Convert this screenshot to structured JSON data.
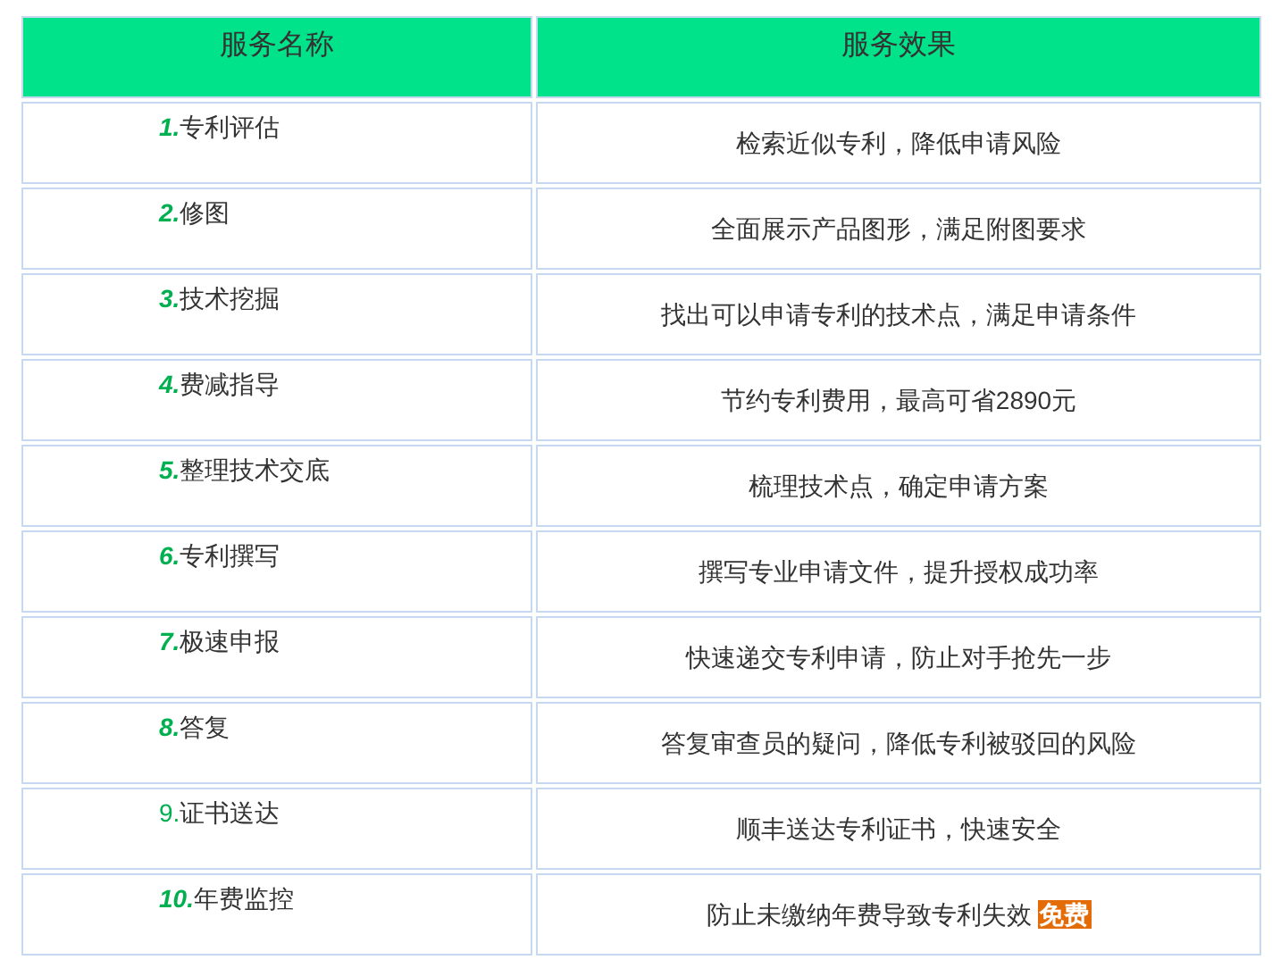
{
  "table": {
    "columns": [
      "服务名称",
      "服务效果"
    ],
    "rows": [
      {
        "number": "1.",
        "kind": "emphasis",
        "name": "专利评估",
        "effect": "检索近似专利，降低申请风险"
      },
      {
        "number": "2.",
        "kind": "emphasis",
        "name": "修图",
        "effect": "全面展示产品图形，满足附图要求"
      },
      {
        "number": "3.",
        "kind": "emphasis",
        "name": "技术挖掘",
        "effect": "找出可以申请专利的技术点，满足申请条件"
      },
      {
        "number": "4.",
        "kind": "emphasis",
        "name": "费减指导",
        "effect": "节约专利费用，最高可省2890元"
      },
      {
        "number": "5.",
        "kind": "emphasis",
        "name": "整理技术交底",
        "effect": "梳理技术点，确定申请方案"
      },
      {
        "number": "6.",
        "kind": "emphasis",
        "name": "专利撰写",
        "effect": "撰写专业申请文件，提升授权成功率"
      },
      {
        "number": "7.",
        "kind": "emphasis",
        "name": "极速申报",
        "effect": "快速递交专利申请，防止对手抢先一步"
      },
      {
        "number": "8.",
        "kind": "emphasis",
        "name": "答复",
        "effect": "答复审查员的疑问，降低专利被驳回的风险"
      },
      {
        "number": "9.",
        "kind": "plain",
        "name": "证书送达",
        "effect": "顺丰送达专利证书，快速安全"
      },
      {
        "number": "10.",
        "kind": "emphasis",
        "name": "年费监控",
        "effect": "防止未缴纳年费导致专利失效",
        "badge": "免费"
      }
    ]
  }
}
